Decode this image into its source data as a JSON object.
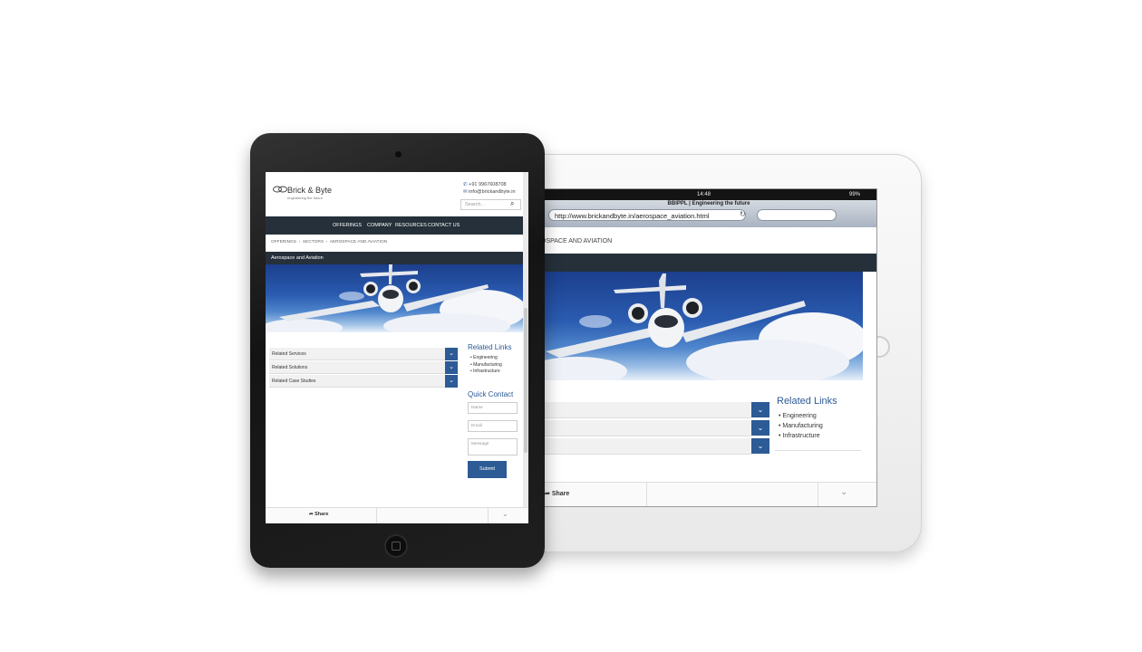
{
  "front_tablet": {
    "header": {
      "brand": "Brick & Byte",
      "tagline": "engineering the future",
      "phone": "+91 9967608708",
      "email": "info@brickandbyte.in",
      "search_placeholder": "Search..."
    },
    "nav": [
      "OFFERINGS",
      "COMPANY",
      "RESOURCES",
      "CONTACT US"
    ],
    "breadcrumb": [
      "OFFERINGS",
      "SECTORS",
      "AEROSPACE AND AVIATION"
    ],
    "hero_title": "Aerospace and Aviation",
    "accordion": [
      "Related Services",
      "Related Solutions",
      "Related Case Studies"
    ],
    "related_links": {
      "title": "Related Links",
      "items": [
        "Engineering",
        "Manufacturing",
        "Infrastructure"
      ]
    },
    "quick_contact": {
      "title": "Quick Contact",
      "name_placeholder": "Name",
      "email_placeholder": "Email",
      "message_placeholder": "Message",
      "submit": "Submit"
    },
    "share": "Share"
  },
  "back_tablet": {
    "status": {
      "time": "14:48",
      "battery": "99%"
    },
    "page_title": "BBIPPL | Engineering the future",
    "url": "http://www.brickandbyte.in/aerospace_aviation.html",
    "breadcrumb_fragment": "OSPACE AND AVIATION",
    "related_links": {
      "title": "Related Links",
      "items": [
        "Engineering",
        "Manufacturing",
        "Infrastructure"
      ]
    },
    "share": "Share"
  }
}
